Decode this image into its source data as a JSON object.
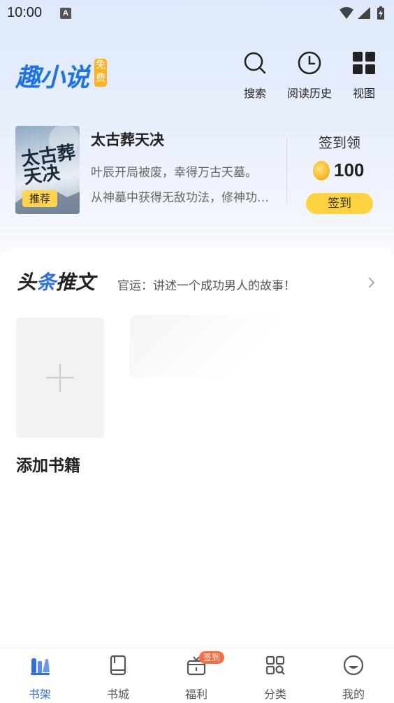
{
  "status_bar": {
    "time": "10:00",
    "indicator": "A"
  },
  "header": {
    "logo_text": "趣小说",
    "logo_badge": "免费",
    "actions": [
      {
        "label": "搜索",
        "icon": "search-icon"
      },
      {
        "label": "阅读历史",
        "icon": "clock-icon"
      },
      {
        "label": "视图",
        "icon": "grid-icon"
      }
    ]
  },
  "recommend": {
    "tag": "推荐",
    "cover_title": "太古葬天决",
    "title": "太古葬天决",
    "desc_line1": "叶辰开局被废，幸得万古天墓。",
    "desc_line2": "从神墓中获得无敌功法，修神功…"
  },
  "checkin": {
    "label": "签到领",
    "coins": "100",
    "button": "签到"
  },
  "toutiao": {
    "logo_part1": "头",
    "logo_part2": "条",
    "logo_part3": "推文",
    "text": "官运：讲述一个成功男人的故事！"
  },
  "shelf": {
    "add_label": "添加书籍"
  },
  "tabbar": {
    "tabs": [
      {
        "label": "书架",
        "icon": "bookshelf-icon",
        "active": true
      },
      {
        "label": "书城",
        "icon": "book-icon"
      },
      {
        "label": "福利",
        "icon": "gift-icon",
        "badge": "签到"
      },
      {
        "label": "分类",
        "icon": "category-icon"
      },
      {
        "label": "我的",
        "icon": "profile-icon"
      }
    ]
  },
  "colors": {
    "accent": "#2f6fe4",
    "brand": "#1d74e8",
    "checkin_button": "#ffd23f",
    "badge": "#ff6a3d"
  }
}
